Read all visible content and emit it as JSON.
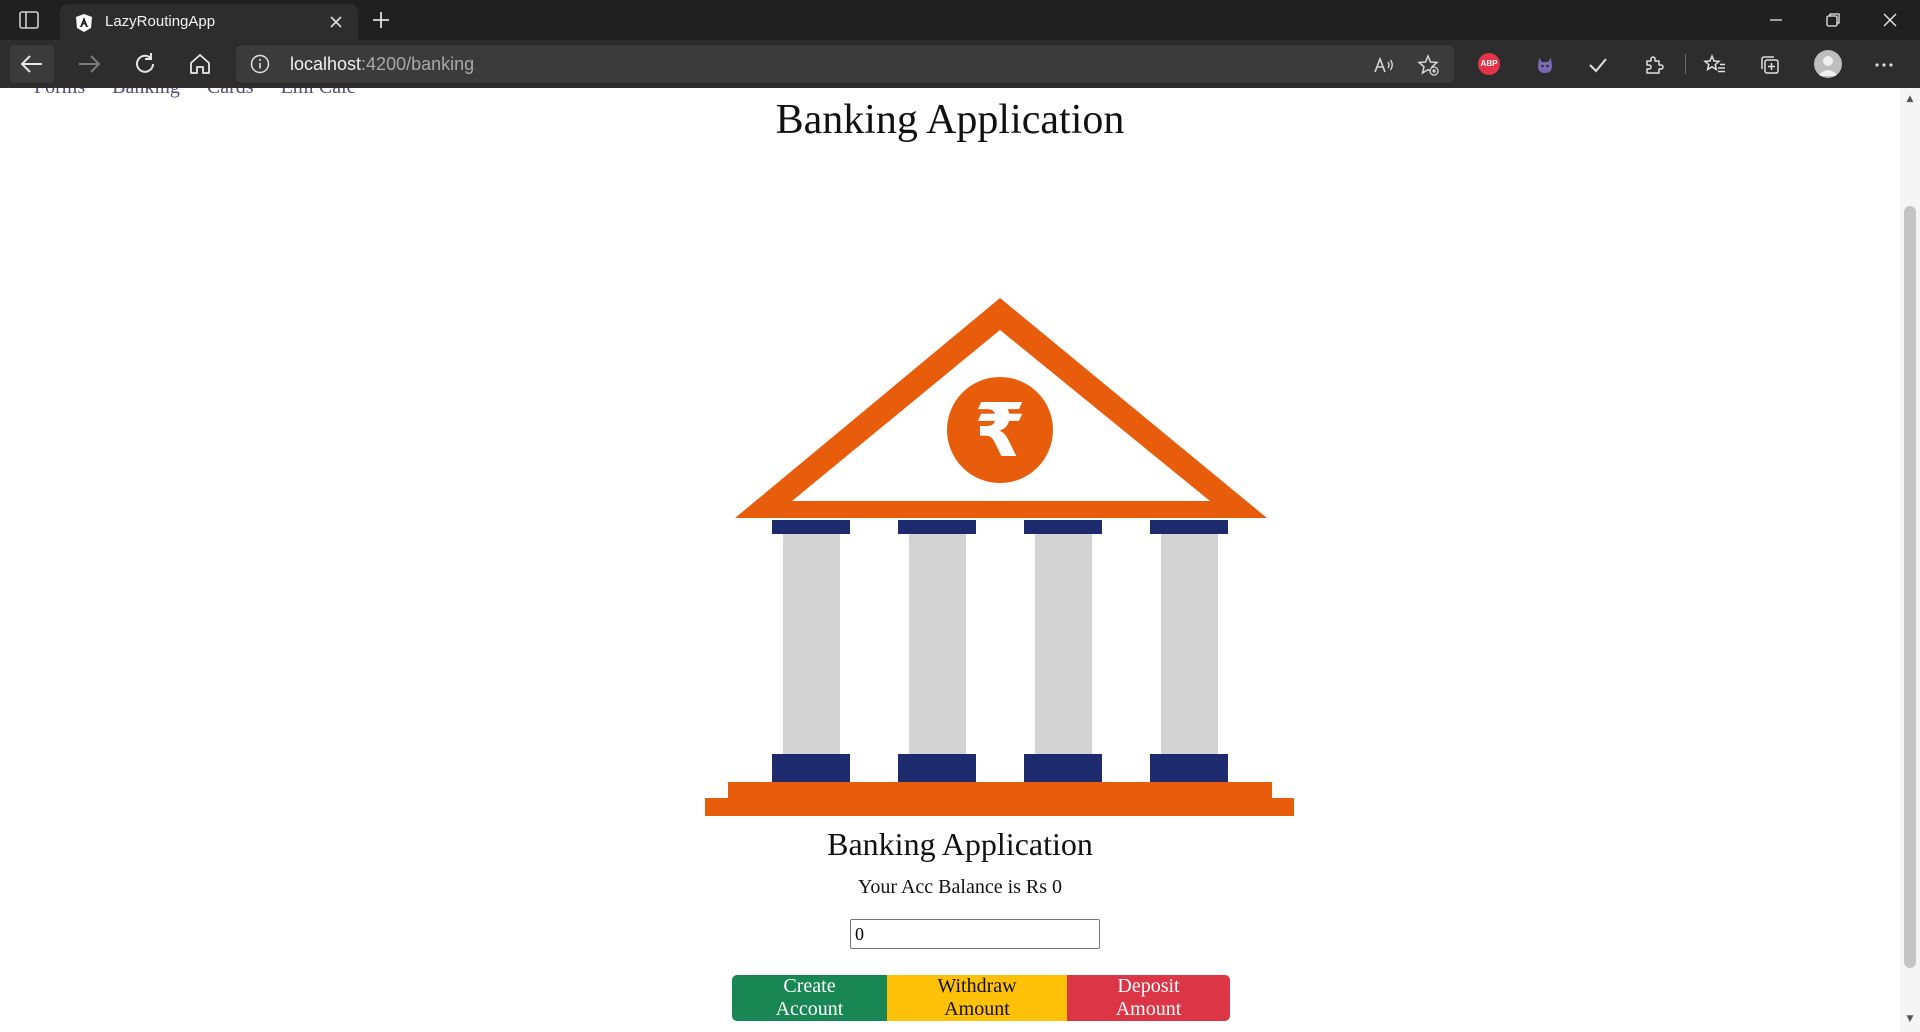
{
  "browser": {
    "tab_title": "LazyRoutingApp",
    "url_host": "localhost",
    "url_rest": ":4200/banking",
    "icons": [
      "tab-actions-icon",
      "angular-icon",
      "close-icon",
      "plus-icon",
      "minimize-icon",
      "restore-icon",
      "close-window-icon",
      "back-arrow-icon",
      "forward-arrow-icon",
      "refresh-icon",
      "home-icon",
      "info-icon",
      "read-aloud-icon",
      "add-favorite-icon",
      "adblock-icon",
      "extension-cat-icon",
      "checkmark-icon",
      "extensions-icon",
      "favorites-icon",
      "collections-icon",
      "profile-icon",
      "more-icon"
    ],
    "abp_label": "ABP"
  },
  "page": {
    "nav_items": [
      "Forms",
      "Banking",
      "Cards",
      "Emi Calc"
    ],
    "title": "Banking Application",
    "subtitle": "Banking Application",
    "balance_text": "Your Acc Balance is Rs 0",
    "amount_value": "0",
    "buttons": {
      "create": "Create Account",
      "withdraw": "Withdraw Amount",
      "deposit": "Deposit Amount"
    },
    "rupee_symbol": "₹"
  },
  "colors": {
    "orange": "#e85d0c",
    "navy": "#1e2a6e",
    "pillar": "#d3d3d3",
    "green": "#198754",
    "yellow": "#ffc107",
    "red": "#dc3545"
  }
}
